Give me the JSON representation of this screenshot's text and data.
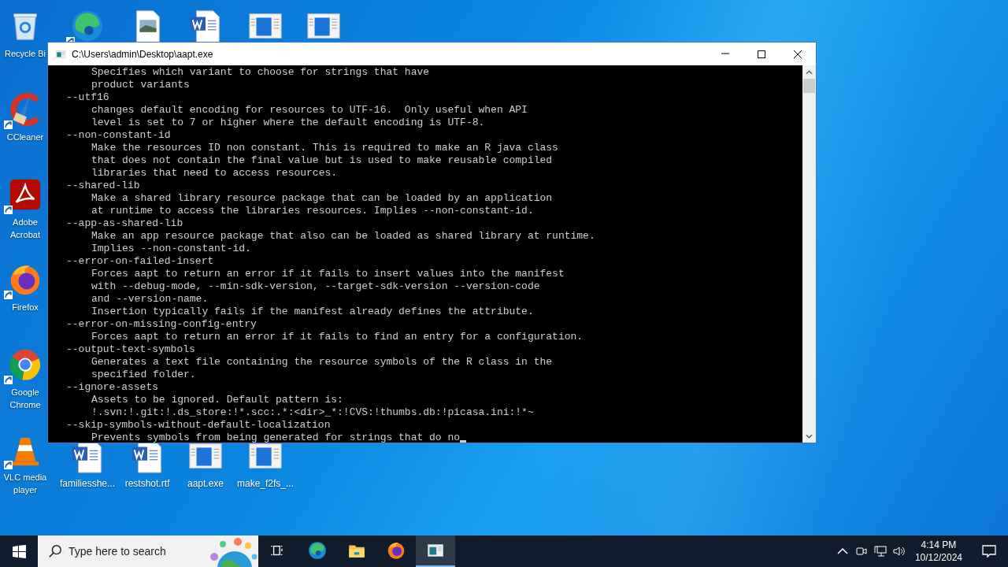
{
  "desktop": {
    "top_icons": [
      {
        "kind": "recycle",
        "label": "Recycle Bi",
        "shortcut": false
      },
      {
        "kind": "edge",
        "shortcut": true
      },
      {
        "kind": "image-doc",
        "shortcut": false
      },
      {
        "kind": "word",
        "shortcut": false
      },
      {
        "kind": "exe",
        "shortcut": false
      },
      {
        "kind": "exe",
        "shortcut": false
      }
    ],
    "left_icons": [
      {
        "kind": "ccleaner",
        "label": "CCleaner",
        "shortcut": true
      },
      {
        "kind": "acrobat",
        "label": "Adobe Acrobat",
        "shortcut": true
      },
      {
        "kind": "firefox",
        "label": "Firefox",
        "shortcut": true
      },
      {
        "kind": "chrome",
        "label": "Google Chrome",
        "shortcut": true
      },
      {
        "kind": "vlc",
        "label": "VLC media player",
        "shortcut": true
      }
    ],
    "bottom_icons": [
      {
        "kind": "word",
        "label": "familiesshe...",
        "shortcut": false
      },
      {
        "kind": "word",
        "label": "restshot.rtf",
        "shortcut": false
      },
      {
        "kind": "exe",
        "label": "aapt.exe",
        "shortcut": false
      },
      {
        "kind": "exe",
        "label": "make_f2fs_...",
        "shortcut": false
      }
    ]
  },
  "window": {
    "title": "C:\\Users\\admin\\Desktop\\aapt.exe",
    "lines": [
      {
        "kind": "desc",
        "text": "Specifies which variant to choose for strings that have"
      },
      {
        "kind": "desc",
        "text": "product variants"
      },
      {
        "kind": "option",
        "text": "--utf16"
      },
      {
        "kind": "desc",
        "text": "changes default encoding for resources to UTF-16.  Only useful when API"
      },
      {
        "kind": "desc",
        "text": "level is set to 7 or higher where the default encoding is UTF-8."
      },
      {
        "kind": "option",
        "text": "--non-constant-id"
      },
      {
        "kind": "desc",
        "text": "Make the resources ID non constant. This is required to make an R java class"
      },
      {
        "kind": "desc",
        "text": "that does not contain the final value but is used to make reusable compiled"
      },
      {
        "kind": "desc",
        "text": "libraries that need to access resources."
      },
      {
        "kind": "option",
        "text": "--shared-lib"
      },
      {
        "kind": "desc",
        "text": "Make a shared library resource package that can be loaded by an application"
      },
      {
        "kind": "desc",
        "text": "at runtime to access the libraries resources. Implies --non-constant-id."
      },
      {
        "kind": "option",
        "text": "--app-as-shared-lib"
      },
      {
        "kind": "desc",
        "text": "Make an app resource package that also can be loaded as shared library at runtime."
      },
      {
        "kind": "desc",
        "text": "Implies --non-constant-id."
      },
      {
        "kind": "option",
        "text": "--error-on-failed-insert"
      },
      {
        "kind": "desc",
        "text": "Forces aapt to return an error if it fails to insert values into the manifest"
      },
      {
        "kind": "desc",
        "text": "with --debug-mode, --min-sdk-version, --target-sdk-version --version-code"
      },
      {
        "kind": "desc",
        "text": "and --version-name."
      },
      {
        "kind": "desc",
        "text": "Insertion typically fails if the manifest already defines the attribute."
      },
      {
        "kind": "option",
        "text": "--error-on-missing-config-entry"
      },
      {
        "kind": "desc",
        "text": "Forces aapt to return an error if it fails to find an entry for a configuration."
      },
      {
        "kind": "option",
        "text": "--output-text-symbols"
      },
      {
        "kind": "desc",
        "text": "Generates a text file containing the resource symbols of the R class in the"
      },
      {
        "kind": "desc",
        "text": "specified folder."
      },
      {
        "kind": "option",
        "text": "--ignore-assets"
      },
      {
        "kind": "desc",
        "text": "Assets to be ignored. Default pattern is:"
      },
      {
        "kind": "desc",
        "text": "!.svn:!.git:!.ds_store:!*.scc:.*:<dir>_*:!CVS:!thumbs.db:!picasa.ini:!*~"
      },
      {
        "kind": "option",
        "text": "--skip-symbols-without-default-localization"
      },
      {
        "kind": "desc",
        "text": "Prevents symbols from being generated for strings that do no",
        "cursor": true
      }
    ]
  },
  "taskbar": {
    "search": {
      "placeholder": "Type here to search"
    },
    "apps": [
      {
        "kind": "taskview",
        "selected": false
      },
      {
        "kind": "edge",
        "selected": false
      },
      {
        "kind": "explorer",
        "selected": false
      },
      {
        "kind": "firefox",
        "selected": false
      },
      {
        "kind": "console",
        "selected": true
      }
    ],
    "time": "4:14 PM",
    "date": "10/12/2024"
  }
}
